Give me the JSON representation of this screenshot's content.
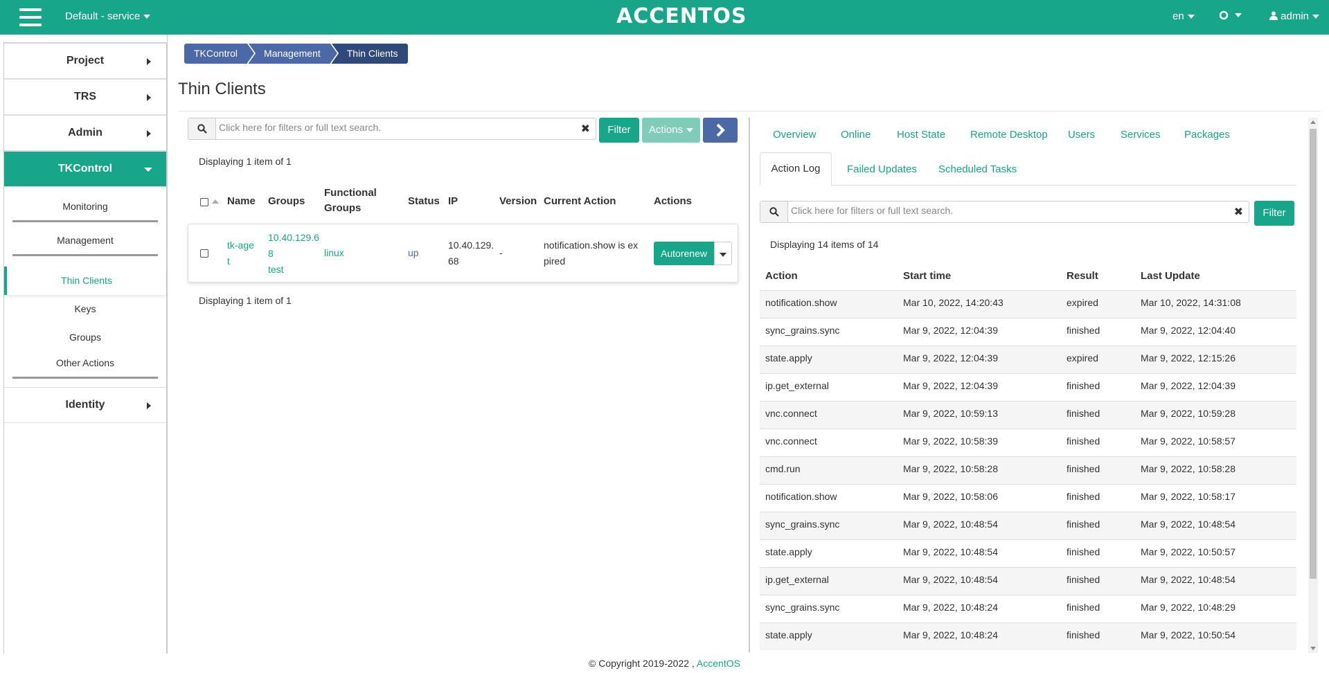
{
  "topbar": {
    "project": "Default - service",
    "logo": "ACCENTOS",
    "lang": "en",
    "user": "admin"
  },
  "sidebar": {
    "items": [
      {
        "label": "Project"
      },
      {
        "label": "TRS"
      },
      {
        "label": "Admin"
      },
      {
        "label": "TKControl"
      },
      {
        "label": "Identity"
      }
    ],
    "tkcontrol": {
      "monitoring": "Monitoring",
      "management": "Management",
      "thin_clients": "Thin Clients",
      "keys": "Keys",
      "groups": "Groups",
      "other_actions": "Other Actions"
    }
  },
  "breadcrumb": [
    "TKControl",
    "Management",
    "Thin Clients"
  ],
  "page_title": "Thin Clients",
  "left": {
    "search_placeholder": "Click here for filters or full text search.",
    "filter_label": "Filter",
    "actions_label": "Actions",
    "displaying_top": "Displaying 1 item of 1",
    "displaying_bottom": "Displaying 1 item of 1",
    "columns": [
      "Name",
      "Groups",
      "Functional Groups",
      "Status",
      "IP",
      "Version",
      "Current Action",
      "Actions"
    ],
    "row": {
      "name_1": "tk-age",
      "name_2": "t",
      "groups_1": "10.40.129.6",
      "groups_2": "8",
      "groups_3": "test",
      "functional_groups": "linux",
      "status": "up",
      "ip_1": "10.40.129.",
      "ip_2": "68",
      "version": "-",
      "current_action_1": "notification.show is ex",
      "current_action_2": "pired",
      "action_button": "Autorenew"
    }
  },
  "right": {
    "tabs_row1": [
      "Overview",
      "Online",
      "Host State",
      "Remote Desktop",
      "Users",
      "Services",
      "Packages"
    ],
    "tabs_row2": [
      "Action Log",
      "Failed Updates",
      "Scheduled Tasks"
    ],
    "search_placeholder": "Click here for filters or full text search.",
    "filter_label": "Filter",
    "displaying": "Displaying 14 items of 14",
    "columns": [
      "Action",
      "Start time",
      "Result",
      "Last Update"
    ],
    "rows": [
      [
        "notification.show",
        "Mar 10, 2022, 14:20:43",
        "expired",
        "Mar 10, 2022, 14:31:08"
      ],
      [
        "sync_grains.sync",
        "Mar 9, 2022, 12:04:39",
        "finished",
        "Mar 9, 2022, 12:04:40"
      ],
      [
        "state.apply",
        "Mar 9, 2022, 12:04:39",
        "expired",
        "Mar 9, 2022, 12:15:26"
      ],
      [
        "ip.get_external",
        "Mar 9, 2022, 12:04:39",
        "finished",
        "Mar 9, 2022, 12:04:39"
      ],
      [
        "vnc.connect",
        "Mar 9, 2022, 10:59:13",
        "finished",
        "Mar 9, 2022, 10:59:28"
      ],
      [
        "vnc.connect",
        "Mar 9, 2022, 10:58:39",
        "finished",
        "Mar 9, 2022, 10:58:57"
      ],
      [
        "cmd.run",
        "Mar 9, 2022, 10:58:28",
        "finished",
        "Mar 9, 2022, 10:58:28"
      ],
      [
        "notification.show",
        "Mar 9, 2022, 10:58:06",
        "finished",
        "Mar 9, 2022, 10:58:17"
      ],
      [
        "sync_grains.sync",
        "Mar 9, 2022, 10:48:54",
        "finished",
        "Mar 9, 2022, 10:48:54"
      ],
      [
        "state.apply",
        "Mar 9, 2022, 10:48:54",
        "finished",
        "Mar 9, 2022, 10:50:57"
      ],
      [
        "ip.get_external",
        "Mar 9, 2022, 10:48:54",
        "finished",
        "Mar 9, 2022, 10:48:54"
      ],
      [
        "sync_grains.sync",
        "Mar 9, 2022, 10:48:24",
        "finished",
        "Mar 9, 2022, 10:48:29"
      ],
      [
        "state.apply",
        "Mar 9, 2022, 10:48:24",
        "finished",
        "Mar 9, 2022, 10:50:54"
      ]
    ]
  },
  "footer": {
    "copyright": "© Copyright 2019-2022 ,",
    "brand": "AccentOS"
  },
  "colors": {
    "accent": "#17a689",
    "breadcrumb": "#4a69a6",
    "breadcrumb_active": "#2f4a7a"
  }
}
